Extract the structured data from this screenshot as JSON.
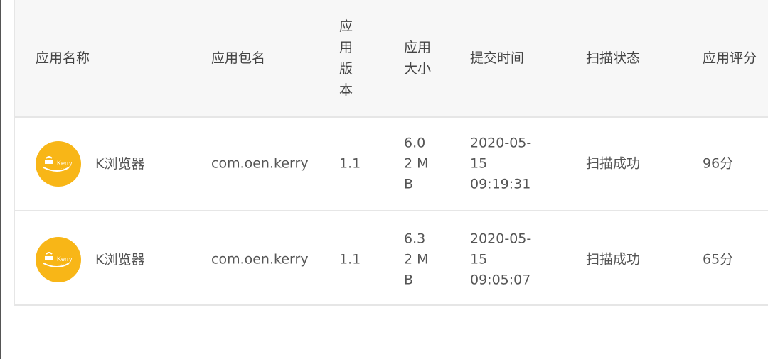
{
  "table": {
    "headers": {
      "name": "应用名称",
      "package": "应用包名",
      "version": "应用版本",
      "size": "应用大小",
      "submit_time": "提交时间",
      "scan_status": "扫描状态",
      "score": "应用评分"
    },
    "rows": [
      {
        "icon": "kerry-app-logo",
        "name": "K浏览器",
        "package": "com.oen.kerry",
        "version": "1.1",
        "size": "6.02 MB",
        "submit_time": "2020-05-15 09:19:31",
        "scan_status": "扫描成功",
        "score": "96分"
      },
      {
        "icon": "kerry-app-logo",
        "name": "K浏览器",
        "package": "com.oen.kerry",
        "version": "1.1",
        "size": "6.32 MB",
        "submit_time": "2020-05-15 09:05:07",
        "scan_status": "扫描成功",
        "score": "65分"
      }
    ]
  },
  "colors": {
    "logo_bg": "#f8b617",
    "header_bg": "#f7f7f7",
    "border": "#e6e6e6"
  }
}
